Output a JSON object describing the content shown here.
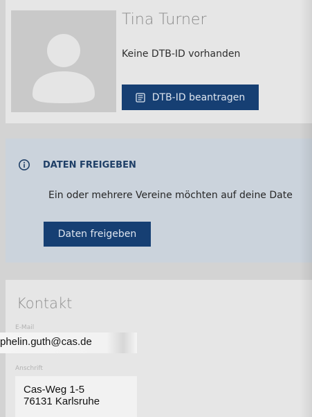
{
  "profile": {
    "name": "Tina Turner",
    "subtitle": "Keine DTB-ID vorhanden",
    "request_button_label": "DTB-ID beantragen",
    "avatar_icon": "user-placeholder-icon",
    "request_button_icon": "id-card-icon"
  },
  "notice": {
    "icon": "info-icon",
    "title": "DATEN FREIGEBEN",
    "text": "Ein oder mehrere Vereine möchten auf deine Date",
    "button_label": "Daten freigeben"
  },
  "contact": {
    "title": "Kontakt",
    "email_label": "E-Mail",
    "email_value": "phelin.guth@cas.de",
    "address_label": "Anschrift",
    "address_lines": [
      "Cas-Weg 1-5",
      "76131 Karlsruhe"
    ]
  },
  "colors": {
    "page_background": "#d3d3d3",
    "card_background": "#e6e6e6",
    "notice_background": "#cbd3dc",
    "primary_button": "#163f73",
    "notice_title": "#1f3f67"
  }
}
